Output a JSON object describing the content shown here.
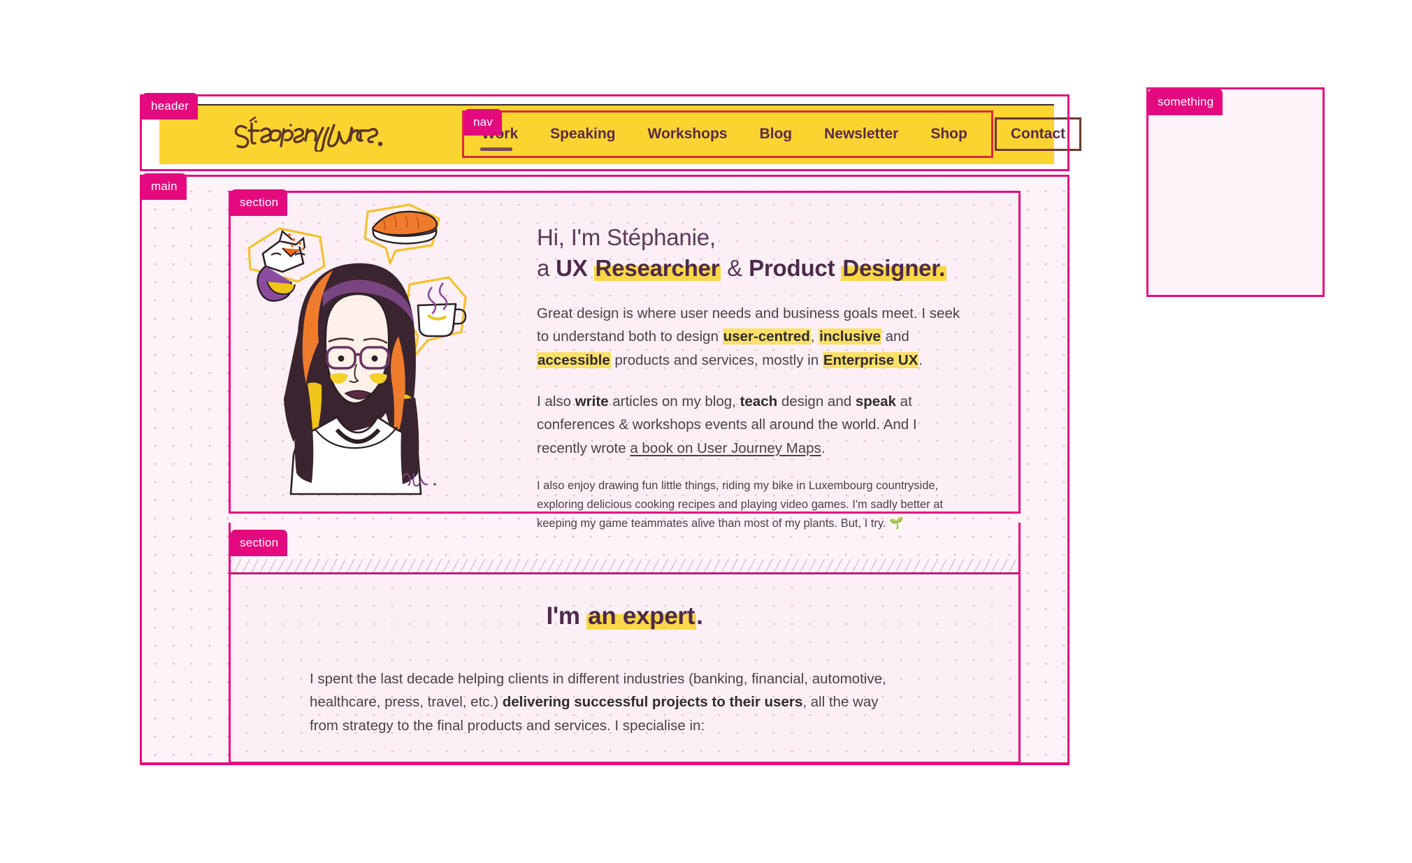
{
  "annotations": {
    "header_label": "header",
    "nav_label": "nav",
    "main_label": "main",
    "section_label": "section",
    "section2_label": "section",
    "something_label": "something"
  },
  "colors": {
    "accent_pink": "#e5097f",
    "header_yellow": "#fcd430",
    "highlight_yellow": "#fcd747",
    "heading_purple": "#4d2a4a",
    "body_text": "#4a4246",
    "nav_border_red": "#d82a3d",
    "page_bg": "#fdf3f8"
  },
  "header": {
    "logo_text": "Stéphanie Walter",
    "nav": {
      "items": [
        {
          "label": "Work",
          "active": true
        },
        {
          "label": "Speaking",
          "active": false
        },
        {
          "label": "Workshops",
          "active": false
        },
        {
          "label": "Blog",
          "active": false
        },
        {
          "label": "Newsletter",
          "active": false
        },
        {
          "label": "Shop",
          "active": false
        }
      ],
      "cta": "Contact"
    }
  },
  "hero": {
    "illustration_alt": "illustrated portrait of Stéphanie with thought bubbles showing a fox, sushi and a cup of coffee",
    "illustration_signature": "ink.",
    "title_line1": "Hi, I'm Stéphanie,",
    "title_line2_prefix": "a ",
    "title_ux": "UX ",
    "title_researcher": "Researcher",
    "title_amp": " & ",
    "title_product": "Product ",
    "title_designer": "Designer.",
    "p1": {
      "part1": "Great design is where user needs and business goals meet. I seek to understand both to design ",
      "hl1": "user-centred",
      "part2": ", ",
      "hl2": "inclusive",
      "part3": " and ",
      "hl3": "accessible",
      "part4": " products and services, mostly in ",
      "hl4": "Enterprise UX",
      "part5": "."
    },
    "p2": {
      "part1": "I also ",
      "b1": "write",
      "part2": " articles on my blog, ",
      "b2": "teach",
      "part3": " design and ",
      "b3": "speak",
      "part4": " at conferences & workshops events all around the world. And I recently wrote ",
      "link": "a book on User Journey Maps",
      "part5": "."
    },
    "p3": "I also enjoy drawing fun little things, riding my bike in Luxembourg countryside, exploring delicious cooking recipes and playing video games. I'm sadly better at keeping my game teammates alive than most of my plants. But, I try. 🌱"
  },
  "expert": {
    "title_prefix": "I'm ",
    "title_highlight": "an expert",
    "title_suffix": ".",
    "paragraph": {
      "part1": "I spent the last decade helping clients in different industries (banking, financial, automotive, healthcare, press, travel, etc.) ",
      "bold": "delivering successful projects to their users",
      "part2": ", all the way from strategy to the final products and services. I specialise in:"
    }
  }
}
